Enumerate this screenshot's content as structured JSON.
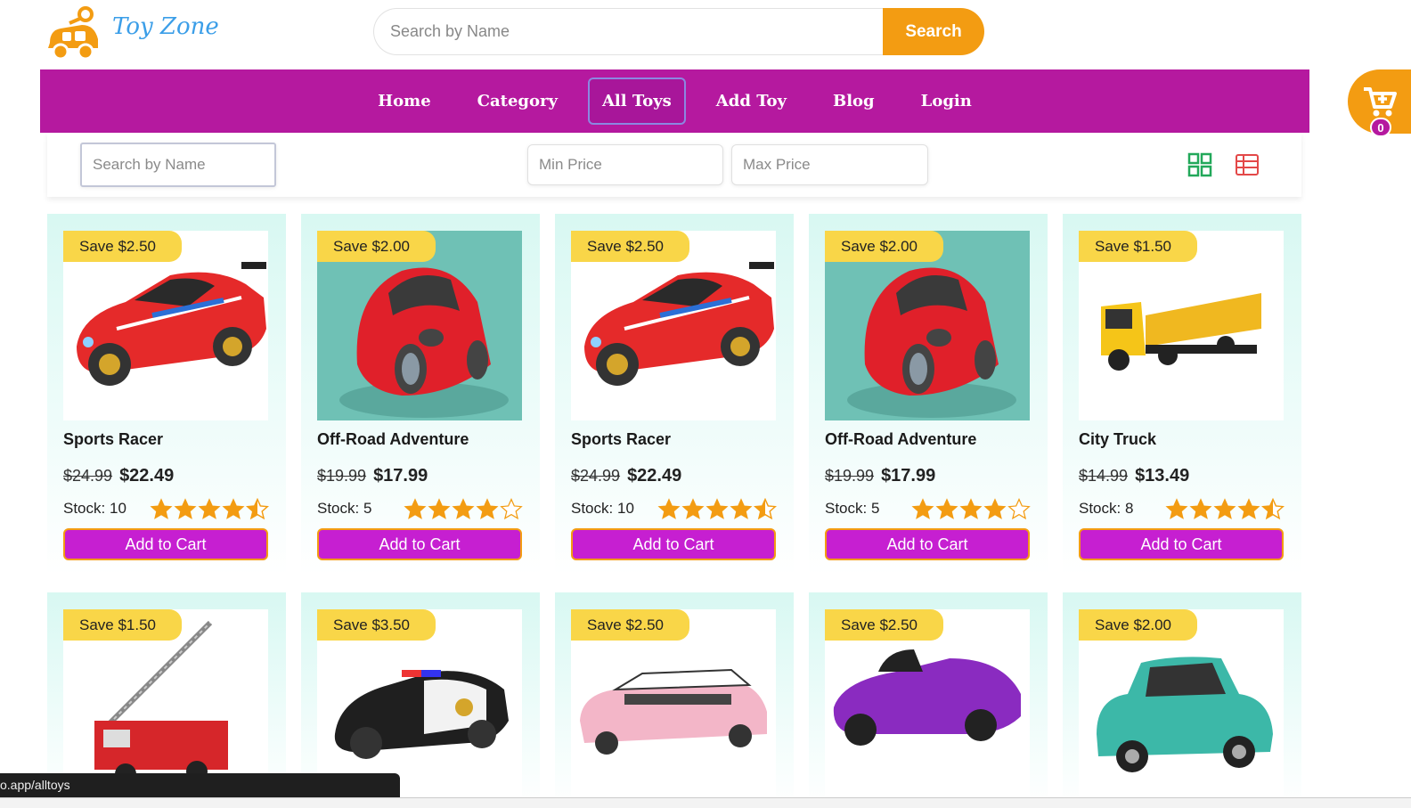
{
  "brand": {
    "name": "Toy Zone"
  },
  "search": {
    "placeholder": "Search by Name",
    "button": "Search"
  },
  "nav": {
    "items": [
      {
        "label": "Home",
        "active": false
      },
      {
        "label": "Category",
        "active": false
      },
      {
        "label": "All Toys",
        "active": true
      },
      {
        "label": "Add Toy",
        "active": false
      },
      {
        "label": "Blog",
        "active": false
      },
      {
        "label": "Login",
        "active": false
      }
    ]
  },
  "cart": {
    "count": "0",
    "icon": "cart-icon"
  },
  "filters": {
    "name_placeholder": "Search by Name",
    "min_placeholder": "Min Price",
    "max_placeholder": "Max Price",
    "grid_icon": "grid-view-icon",
    "table_icon": "table-view-icon"
  },
  "colors": {
    "nav": "#b5199f",
    "accent": "#f39c12",
    "button": "#c61fd1",
    "tag": "#f9d648"
  },
  "products": [
    {
      "save": "Save $2.50",
      "name": "Sports Racer",
      "old_price": "$24.99",
      "price": "$22.49",
      "stock_label": "Stock:",
      "stock": "10",
      "rating": 4.5,
      "button": "Add to Cart",
      "image": "red-sports-car"
    },
    {
      "save": "Save $2.00",
      "name": "Off-Road Adventure",
      "old_price": "$19.99",
      "price": "$17.99",
      "stock_label": "Stock:",
      "stock": "5",
      "rating": 4,
      "button": "Add to Cart",
      "image": "red-beetle-car"
    },
    {
      "save": "Save $2.50",
      "name": "Sports Racer",
      "old_price": "$24.99",
      "price": "$22.49",
      "stock_label": "Stock:",
      "stock": "10",
      "rating": 4.5,
      "button": "Add to Cart",
      "image": "red-sports-car"
    },
    {
      "save": "Save $2.00",
      "name": "Off-Road Adventure",
      "old_price": "$19.99",
      "price": "$17.99",
      "stock_label": "Stock:",
      "stock": "5",
      "rating": 4,
      "button": "Add to Cart",
      "image": "red-beetle-car"
    },
    {
      "save": "Save $1.50",
      "name": "City Truck",
      "old_price": "$14.99",
      "price": "$13.49",
      "stock_label": "Stock:",
      "stock": "8",
      "rating": 4.5,
      "button": "Add to Cart",
      "image": "yellow-truck"
    },
    {
      "save": "Save $1.50",
      "image": "fire-truck"
    },
    {
      "save": "Save $3.50",
      "image": "police-car"
    },
    {
      "save": "Save $2.50",
      "image": "pink-limo"
    },
    {
      "save": "Save $2.50",
      "image": "purple-supercar"
    },
    {
      "save": "Save $2.00",
      "image": "teal-mini-car"
    }
  ],
  "statusbar": {
    "url": "o.app/alltoys"
  }
}
